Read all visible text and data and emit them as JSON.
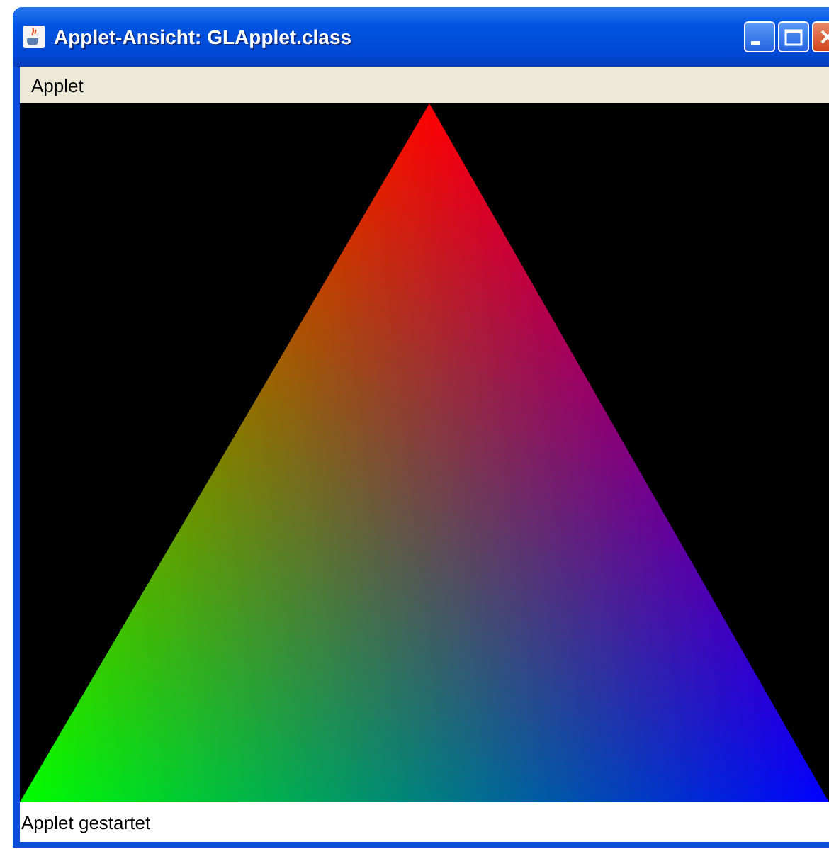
{
  "window": {
    "title": "Applet-Ansicht: GLApplet.class"
  },
  "menu_bar": {
    "items": [
      "Applet"
    ]
  },
  "status_bar": {
    "text": "Applet gestartet"
  }
}
